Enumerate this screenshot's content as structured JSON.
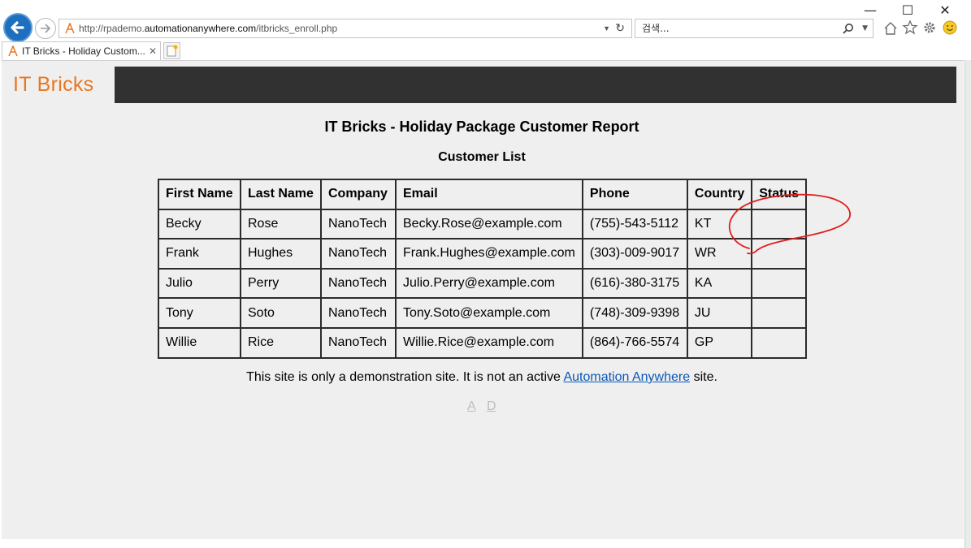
{
  "browser": {
    "url_prefix": "http://rpademo.",
    "url_domain": "automationanywhere.com",
    "url_path": "/itbricks_enroll.php",
    "search_placeholder": "검색...",
    "tab_title": "IT Bricks - Holiday Custom...",
    "window_controls": {
      "minimize": "—",
      "maximize": "☐",
      "close": "✕"
    }
  },
  "page": {
    "logo": "IT Bricks",
    "title": "IT Bricks - Holiday Package Customer Report",
    "subtitle": "Customer List",
    "columns": [
      "First Name",
      "Last Name",
      "Company",
      "Email",
      "Phone",
      "Country",
      "Status"
    ],
    "rows": [
      [
        "Becky",
        "Rose",
        "NanoTech",
        "Becky.Rose@example.com",
        "(755)-543-5112",
        "KT",
        ""
      ],
      [
        "Frank",
        "Hughes",
        "NanoTech",
        "Frank.Hughes@example.com",
        "(303)-009-9017",
        "WR",
        ""
      ],
      [
        "Julio",
        "Perry",
        "NanoTech",
        "Julio.Perry@example.com",
        "(616)-380-3175",
        "KA",
        ""
      ],
      [
        "Tony",
        "Soto",
        "NanoTech",
        "Tony.Soto@example.com",
        "(748)-309-9398",
        "JU",
        ""
      ],
      [
        "Willie",
        "Rice",
        "NanoTech",
        "Willie.Rice@example.com",
        "(864)-766-5574",
        "GP",
        ""
      ]
    ],
    "footer_before": "This site is only a demonstration site. It is not an active ",
    "footer_link": "Automation Anywhere",
    "footer_after": " site.",
    "link_a": "A",
    "link_d": "D"
  },
  "colors": {
    "logo": "#e87722",
    "header_bar": "#313131",
    "link": "#0a58b8",
    "annotation": "#e21c1c"
  }
}
